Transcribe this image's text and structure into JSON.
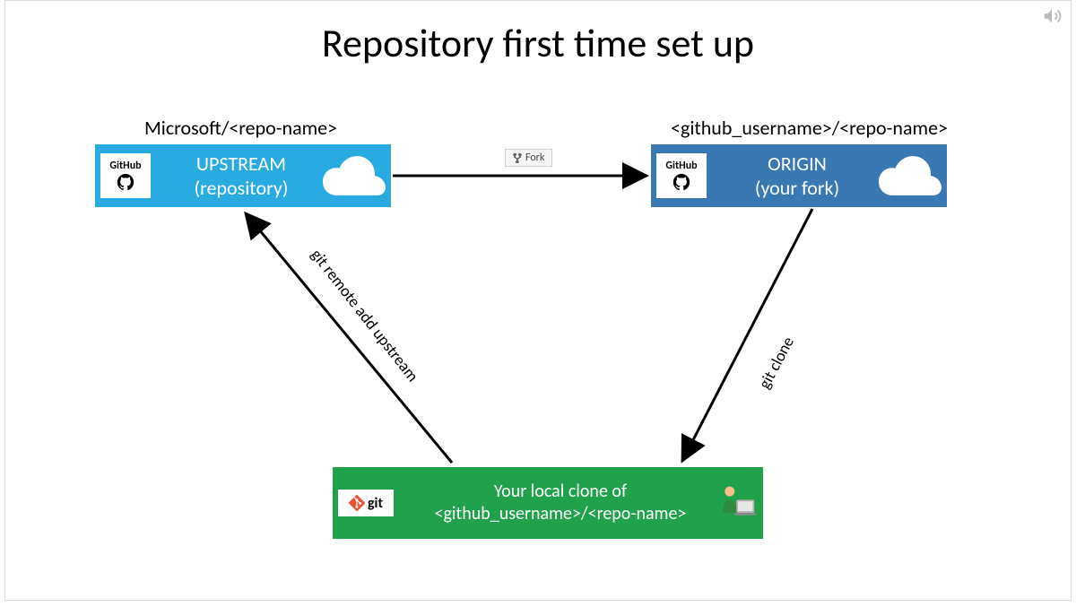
{
  "title": "Repository first time set up",
  "upstream": {
    "label": "Microsoft/<repo-name>",
    "line1": "UPSTREAM",
    "line2": "(repository)",
    "badge": "GitHub"
  },
  "origin": {
    "label": "<github_username>/<repo-name>",
    "line1": "ORIGIN",
    "line2": "(your fork)",
    "badge": "GitHub"
  },
  "local": {
    "line1": "Your local clone of",
    "line2": "<github_username>/<repo-name>",
    "badge": "git"
  },
  "arrows": {
    "fork": "Fork",
    "remote_add": "git remote add upstream",
    "clone": "git clone"
  },
  "colors": {
    "upstream": "#29abe2",
    "origin": "#3a78b4",
    "local": "#1fa24a"
  }
}
